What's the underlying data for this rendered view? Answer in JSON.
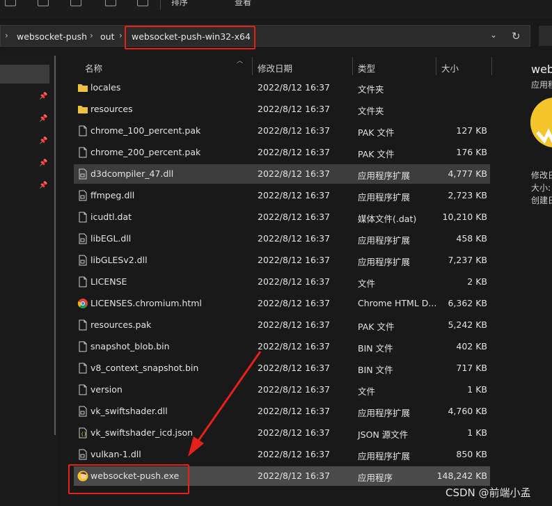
{
  "toolbar": {
    "items": [
      {
        "icon": "copy-icon"
      },
      {
        "icon": "paste-icon"
      },
      {
        "icon": "share-icon"
      },
      {
        "icon": "delete-icon"
      }
    ],
    "sort_label": "排序",
    "view_label": "查看"
  },
  "address": {
    "segments": [
      "websocket-push",
      "out",
      "websocket-push-win32-x64"
    ],
    "dropdown_icon": "chevron-down-icon",
    "refresh_icon": "refresh-icon"
  },
  "columns": {
    "name": "名称",
    "date": "修改日期",
    "type": "类型",
    "size": "大小"
  },
  "files": [
    {
      "name": "locales",
      "date": "2022/8/12 16:37",
      "type": "文件夹",
      "size": "",
      "icon": "folder-icon"
    },
    {
      "name": "resources",
      "date": "2022/8/12 16:37",
      "type": "文件夹",
      "size": "",
      "icon": "folder-icon"
    },
    {
      "name": "chrome_100_percent.pak",
      "date": "2022/8/12 16:37",
      "type": "PAK 文件",
      "size": "127 KB",
      "icon": "file-icon"
    },
    {
      "name": "chrome_200_percent.pak",
      "date": "2022/8/12 16:37",
      "type": "PAK 文件",
      "size": "176 KB",
      "icon": "file-icon"
    },
    {
      "name": "d3dcompiler_47.dll",
      "date": "2022/8/12 16:37",
      "type": "应用程序扩展",
      "size": "4,777 KB",
      "icon": "dll-icon"
    },
    {
      "name": "ffmpeg.dll",
      "date": "2022/8/12 16:37",
      "type": "应用程序扩展",
      "size": "2,723 KB",
      "icon": "dll-icon"
    },
    {
      "name": "icudtl.dat",
      "date": "2022/8/12 16:37",
      "type": "媒体文件(.dat)",
      "size": "10,210 KB",
      "icon": "file-icon"
    },
    {
      "name": "libEGL.dll",
      "date": "2022/8/12 16:37",
      "type": "应用程序扩展",
      "size": "458 KB",
      "icon": "dll-icon"
    },
    {
      "name": "libGLESv2.dll",
      "date": "2022/8/12 16:37",
      "type": "应用程序扩展",
      "size": "7,237 KB",
      "icon": "dll-icon"
    },
    {
      "name": "LICENSE",
      "date": "2022/8/12 16:37",
      "type": "文件",
      "size": "2 KB",
      "icon": "file-icon"
    },
    {
      "name": "LICENSES.chromium.html",
      "date": "2022/8/12 16:37",
      "type": "Chrome HTML D...",
      "size": "6,362 KB",
      "icon": "chrome-icon"
    },
    {
      "name": "resources.pak",
      "date": "2022/8/12 16:37",
      "type": "PAK 文件",
      "size": "5,242 KB",
      "icon": "file-icon"
    },
    {
      "name": "snapshot_blob.bin",
      "date": "2022/8/12 16:37",
      "type": "BIN 文件",
      "size": "402 KB",
      "icon": "file-icon"
    },
    {
      "name": "v8_context_snapshot.bin",
      "date": "2022/8/12 16:37",
      "type": "BIN 文件",
      "size": "717 KB",
      "icon": "file-icon"
    },
    {
      "name": "version",
      "date": "2022/8/12 16:37",
      "type": "文件",
      "size": "1 KB",
      "icon": "file-icon"
    },
    {
      "name": "vk_swiftshader.dll",
      "date": "2022/8/12 16:37",
      "type": "应用程序扩展",
      "size": "4,760 KB",
      "icon": "dll-icon"
    },
    {
      "name": "vk_swiftshader_icd.json",
      "date": "2022/8/12 16:37",
      "type": "JSON 源文件",
      "size": "1 KB",
      "icon": "json-icon"
    },
    {
      "name": "vulkan-1.dll",
      "date": "2022/8/12 16:37",
      "type": "应用程序扩展",
      "size": "850 KB",
      "icon": "dll-icon"
    },
    {
      "name": "websocket-push.exe",
      "date": "2022/8/12 16:37",
      "type": "应用程序",
      "size": "148,242 KB",
      "icon": "app-icon"
    }
  ],
  "details": {
    "title": "web",
    "subtitle": "应用程",
    "modified_label": "修改日",
    "size_label": "大小:",
    "created_label": "创建日"
  },
  "watermark": "CSDN @前端小孟",
  "colors": {
    "highlight": "#e8201b",
    "folder": "#f0c040",
    "selected_row": "#4a4a4a"
  }
}
